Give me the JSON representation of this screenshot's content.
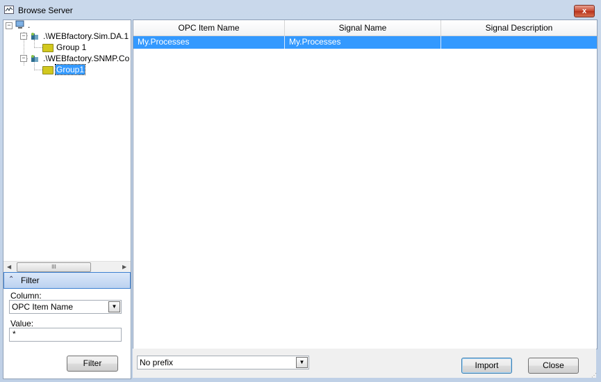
{
  "window": {
    "title": "Browse Server",
    "close_glyph": "x"
  },
  "tree": {
    "root_label": ".",
    "servers": [
      {
        "label": ".\\WEBfactory.Sim.DA.1",
        "children": [
          "Group 1"
        ]
      },
      {
        "label": ".\\WEBfactory.SNMP.Co",
        "children": [
          "Group1"
        ]
      }
    ],
    "selected": "Group1"
  },
  "scrollbar": {
    "thumb_glyph": "III"
  },
  "filter": {
    "header": "Filter",
    "column_label": "Column:",
    "column_value": "OPC Item Name",
    "value_label": "Value:",
    "value_text": "*",
    "button": "Filter"
  },
  "grid": {
    "columns": [
      "OPC Item Name",
      "Signal Name",
      "Signal Description"
    ],
    "rows": [
      [
        "My.Processes",
        "My.Processes",
        ""
      ]
    ]
  },
  "bottom": {
    "prefix_value": "No prefix",
    "import_button": "Import",
    "close_button": "Close"
  },
  "icons": {
    "computer": "computer-icon",
    "server": "opc-server-icon",
    "folder": "folder-icon"
  }
}
